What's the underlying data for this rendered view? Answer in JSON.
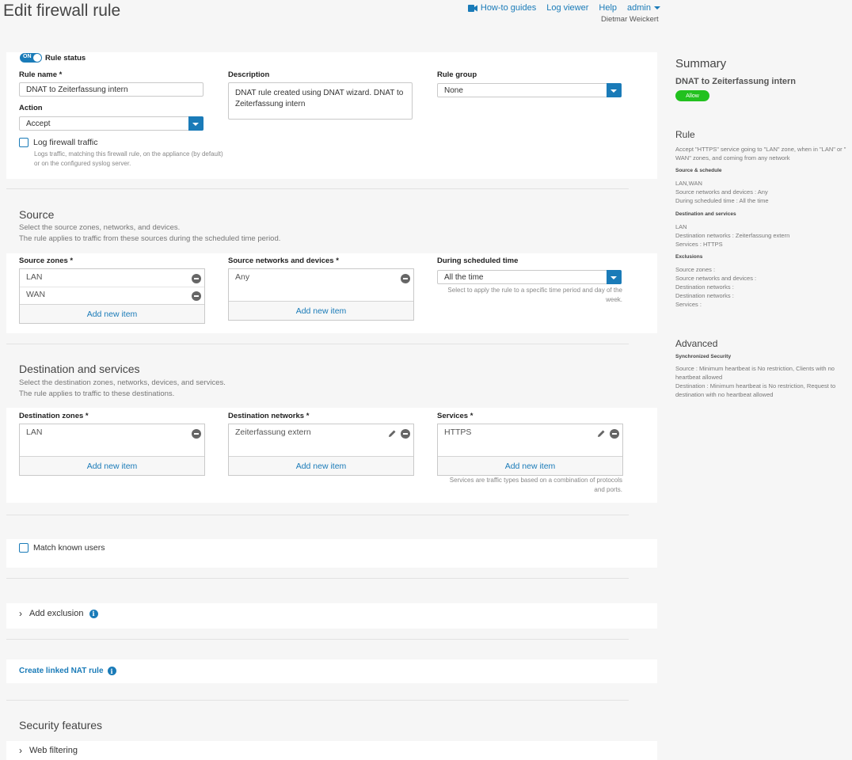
{
  "header": {
    "title": "Edit firewall rule",
    "nav": {
      "howto": "How-to guides",
      "logviewer": "Log viewer",
      "help": "Help",
      "admin": "admin"
    },
    "user": "Dietmar Weickert"
  },
  "rule": {
    "toggle_label": "ON",
    "status_label": "Rule status",
    "name_label": "Rule name *",
    "name_value": "DNAT to Zeiterfassung intern",
    "description_label": "Description",
    "description_value": "DNAT rule created using DNAT wizard. DNAT to Zeiterfassung intern",
    "group_label": "Rule group",
    "group_value": "None",
    "action_label": "Action",
    "action_value": "Accept",
    "log_label": "Log firewall traffic",
    "log_hint": "Logs traffic, matching this firewall rule, on the appliance (by default) or on the configured syslog server."
  },
  "source": {
    "title": "Source",
    "desc1": "Select the source zones, networks, and devices.",
    "desc2": "The rule applies to traffic from these sources during the scheduled time period.",
    "zones_label": "Source zones *",
    "zones": [
      "LAN",
      "WAN"
    ],
    "networks_label": "Source networks and devices *",
    "networks": [
      "Any"
    ],
    "schedule_label": "During scheduled time",
    "schedule_value": "All the time",
    "schedule_hint": "Select to apply the rule to a specific time period and day of the week.",
    "add_new": "Add new item"
  },
  "destination": {
    "title": "Destination and services",
    "desc1": "Select the destination zones, networks, devices, and services.",
    "desc2": "The rule applies to traffic to these destinations.",
    "zones_label": "Destination zones *",
    "zones": [
      "LAN"
    ],
    "networks_label": "Destination networks *",
    "networks": [
      "Zeiterfassung extern"
    ],
    "services_label": "Services *",
    "services": [
      "HTTPS"
    ],
    "services_hint": "Services are traffic types based on a combination of protocols and ports.",
    "add_new": "Add new item"
  },
  "users": {
    "match_label": "Match known users"
  },
  "exclusion": {
    "label": "Add exclusion"
  },
  "nat": {
    "label": "Create linked NAT rule"
  },
  "security": {
    "title": "Security features",
    "web_filtering": "Web filtering"
  },
  "summary": {
    "title": "Summary",
    "rule_name": "DNAT to Zeiterfassung intern",
    "badge": "Allow",
    "rule_heading": "Rule",
    "rule_desc": "Accept \"HTTPS\" service going to \"LAN\" zone, when in \"LAN\" or \" WAN\" zones, and coming from any network",
    "src_heading": "Source & schedule",
    "src_lines": [
      "LAN,WAN",
      "Source networks and devices : Any",
      "During scheduled time : All the time"
    ],
    "dst_heading": "Destination and services",
    "dst_lines": [
      "LAN",
      "Destination networks : Zeiterfassung extern",
      "Services : HTTPS"
    ],
    "excl_heading": "Exclusions",
    "excl_lines": [
      "Source zones :",
      "Source networks and devices :",
      "Destination networks :",
      "Destination networks :",
      "Services :"
    ],
    "adv_heading": "Advanced",
    "sync_heading": "Synchronized Security",
    "sync_lines": [
      "Source : Minimum heartbeat is No restriction, Clients with no heartbeat allowed",
      "Destination : Minimum heartbeat is No restriction, Request to destination with no heartbeat allowed"
    ]
  },
  "colors": {
    "accent": "#1a7bb8",
    "allow": "#22c11f"
  }
}
